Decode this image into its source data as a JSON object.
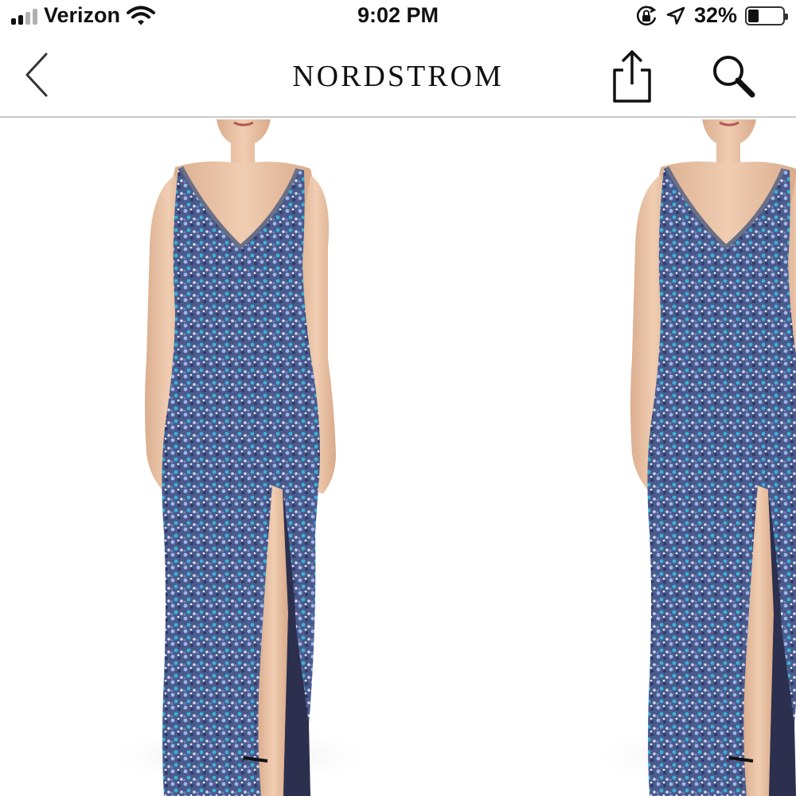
{
  "status_bar": {
    "carrier": "Verizon",
    "time": "9:02 PM",
    "battery_percent_text": "32%",
    "battery_level": 0.32,
    "signal_bars_active": 2,
    "signal_bars_total": 4,
    "icons": [
      "signal-bars-icon",
      "wifi-icon",
      "orientation-lock-icon",
      "location-arrow-icon",
      "battery-icon"
    ]
  },
  "nav": {
    "brand": "NORDSTROM",
    "icons": [
      "back-chevron-icon",
      "share-icon",
      "search-icon"
    ]
  },
  "gallery": {
    "images": [
      {
        "name": "product-image-main",
        "subject": "sleeveless v-neck sequin gown with front slit"
      },
      {
        "name": "product-image-next",
        "subject": "sleeveless v-neck sequin gown with front slit"
      }
    ]
  },
  "colors": {
    "dress_base": "#4a5a8c",
    "dress_highlight": "#9fb7e6",
    "dress_sequin_teal": "#3ab2d6",
    "skin": "#e9c2a4",
    "lining": "#2c2f4d",
    "divider": "#c9c9c9",
    "text": "#111111"
  }
}
